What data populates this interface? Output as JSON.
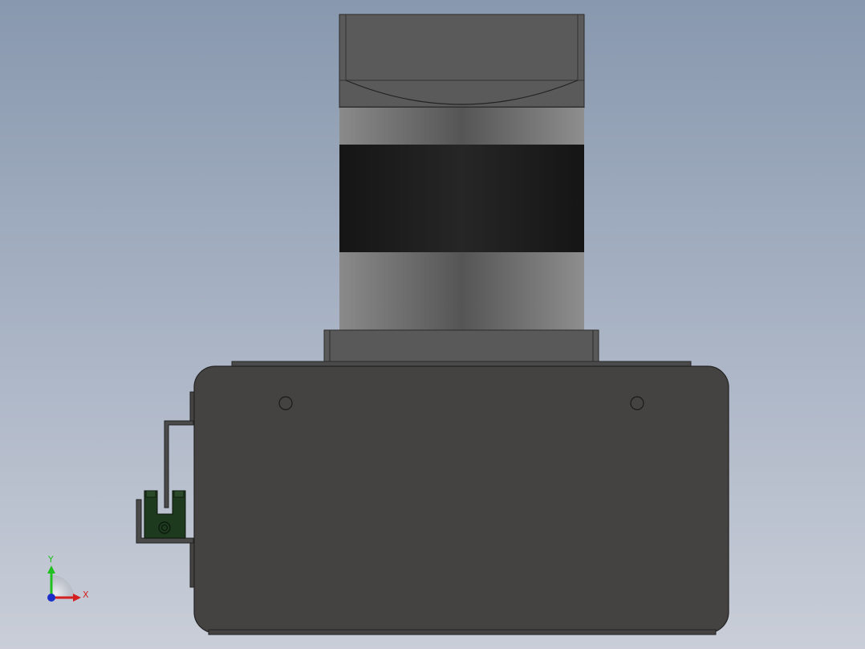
{
  "viewport": {
    "background_top": "#8898ae",
    "background_bottom": "#c9ced8"
  },
  "triad": {
    "x_label": "X",
    "y_label": "Y",
    "x_color": "#d42020",
    "y_color": "#20c020",
    "z_color": "#1c2ec8"
  },
  "model": {
    "body_color": "#454341",
    "motor_cap_color": "#5a5a5a",
    "motor_band_color": "#1a1a1a",
    "sensor_color": "#1e3a1e"
  }
}
